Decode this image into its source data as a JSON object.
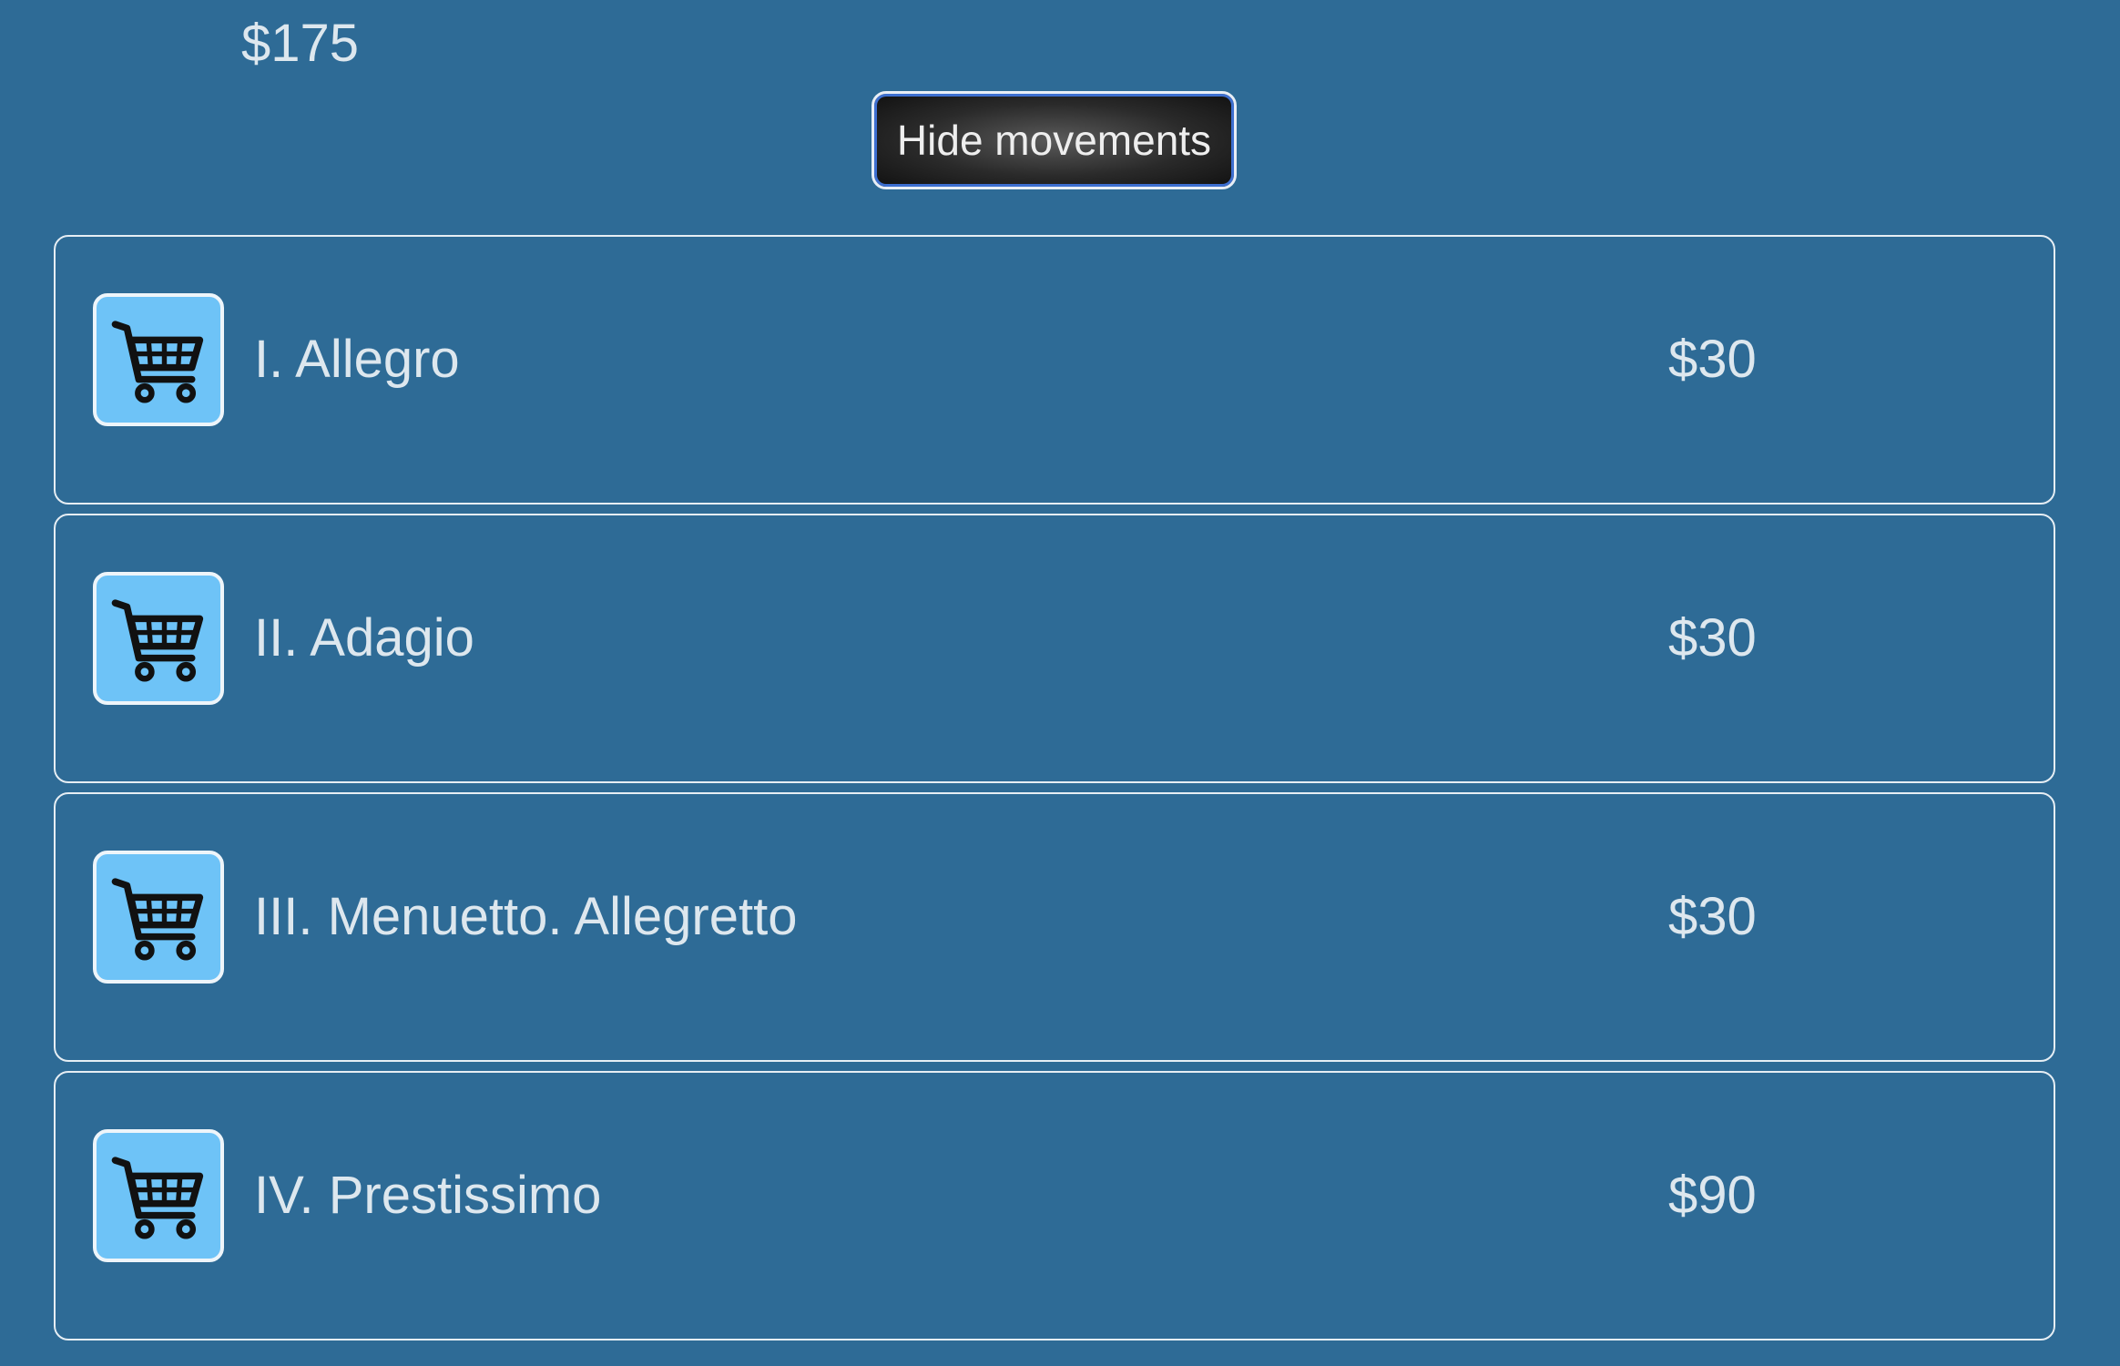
{
  "summary": {
    "total_price": "$175",
    "toggle_label": "Hide movements"
  },
  "movements": [
    {
      "title": "I. Allegro",
      "price": "$30",
      "icon": "shopping-cart-icon"
    },
    {
      "title": "II. Adagio",
      "price": "$30",
      "icon": "shopping-cart-icon"
    },
    {
      "title": "III. Menuetto. Allegretto",
      "price": "$30",
      "icon": "shopping-cart-icon"
    },
    {
      "title": "IV. Prestissimo",
      "price": "$90",
      "icon": "shopping-cart-icon"
    }
  ],
  "colors": {
    "background": "#2e6b96",
    "cart_button": "#6ec3f7",
    "text": "#dde7ee",
    "border": "#e6eef4"
  }
}
